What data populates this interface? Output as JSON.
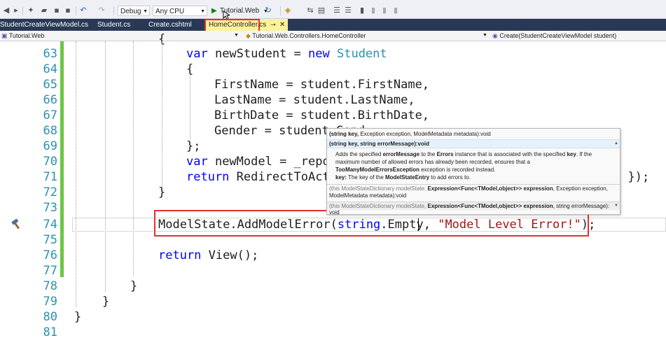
{
  "toolbar": {
    "configuration": "Debug",
    "platform": "Any CPU",
    "start_target": "Tutorial.Web"
  },
  "tabs": [
    {
      "label": "StudentCreateViewModel.cs"
    },
    {
      "label": "Student.cs"
    },
    {
      "label": "Create.cshtml"
    },
    {
      "label": "HomeController.cs",
      "active": true
    }
  ],
  "nav": {
    "project": "Tutorial.Web",
    "class": "Tutorial.Web.Controllers.HomeController",
    "member": "Create(StudentCreateViewModel student)"
  },
  "line_numbers": [
    "63",
    "64",
    "65",
    "66",
    "67",
    "68",
    "69",
    "70",
    "71",
    "72",
    "73",
    "74",
    "75",
    "76",
    "77",
    "78",
    "79",
    "80",
    "81"
  ],
  "code": {
    "l63_kw1": "var",
    "l63_mid": " newStudent = ",
    "l63_kw2": "new",
    "l63_type": "Student",
    "l64": "{",
    "l65": "FirstName = student.FirstName,",
    "l66": "LastName = student.LastName,",
    "l67": "BirthDate = student.BirthDate,",
    "l68": "Gender = student.Gend",
    "l69": "};",
    "l70_kw": "var",
    "l70_rest": " newModel = _repo",
    "l71_kw": "return",
    "l71_rest": " RedirectToAct",
    "l71_tail": "d });",
    "l72": "}",
    "l74_pre": "ModelState.AddModelError(",
    "l74_kw": "string",
    "l74_mid": ".Empty",
    "l74_comma": ", ",
    "l74_str": "\"Model Level Error!\"",
    "l74_end": ");",
    "l76_kw": "return",
    "l76_rest": " View();",
    "l78": "}",
    "l79": "}",
    "l80": "}"
  },
  "tooltip": {
    "o1_open": "(string key, ",
    "o1_rest": "Exception exception, ModelMetadata metadata):void",
    "o2_sig": "(string key, string errorMessage):void",
    "o2_d1a": "Adds the specified ",
    "o2_d1b": "errorMessage",
    "o2_d1c": " to the ",
    "o2_d1d": "Errors",
    "o2_d1e": " instance that is associated with the specified ",
    "o2_d1f": "key",
    "o2_d1g": ". If the",
    "o2_d2": "maximum number of allowed errors has already been recorded, ensures that a",
    "o2_d3a": "TooManyModelErrorsException",
    "o2_d3b": " exception is recorded instead.",
    "o2_d4a": "key:",
    "o2_d4b": " The key of the ",
    "o2_d4c": "ModelStateEntry",
    "o2_d4d": " to add errors to.",
    "o3_this": "(this ",
    "o3_a": "ModelStateDictionary modelState, ",
    "o3_b": "Expression<Func<TModel,object>> expression",
    "o3_c": ", Exception exception,",
    "o3_l2": "ModelMetadata metadata):void",
    "o4_this": "(this ",
    "o4_a": "ModelStateDictionary modelState, ",
    "o4_b": "Expression<Func<TModel,object>> expression",
    "o4_c": ", string errorMessage):",
    "o4_l2": "void"
  },
  "colors": {
    "tab_bar": "#293955",
    "active_tab": "#fff29d",
    "highlight_box": "#e2302f",
    "change_margin": "#6cc644",
    "keyword": "#0000ff",
    "type": "#2b91af",
    "string": "#a31515"
  }
}
